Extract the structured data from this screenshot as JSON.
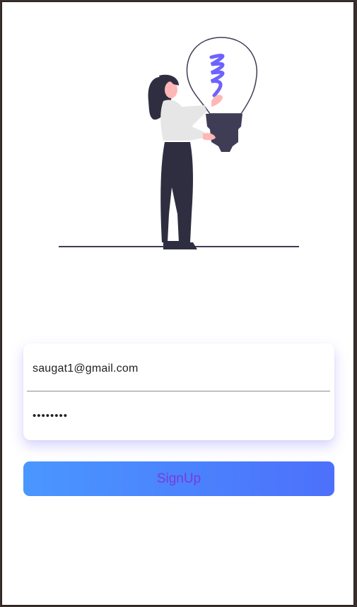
{
  "form": {
    "email_value": "saugat1@gmail.com",
    "password_value": "••••••••"
  },
  "signup_button": {
    "label": "SignUp"
  },
  "colors": {
    "button_gradient_start": "#4a97ff",
    "button_gradient_end": "#4c70fb",
    "button_text": "#7a3bd6",
    "accent": "#6c63ff"
  },
  "icons": {
    "illustration": "woman-holding-lightbulb-illustration"
  }
}
